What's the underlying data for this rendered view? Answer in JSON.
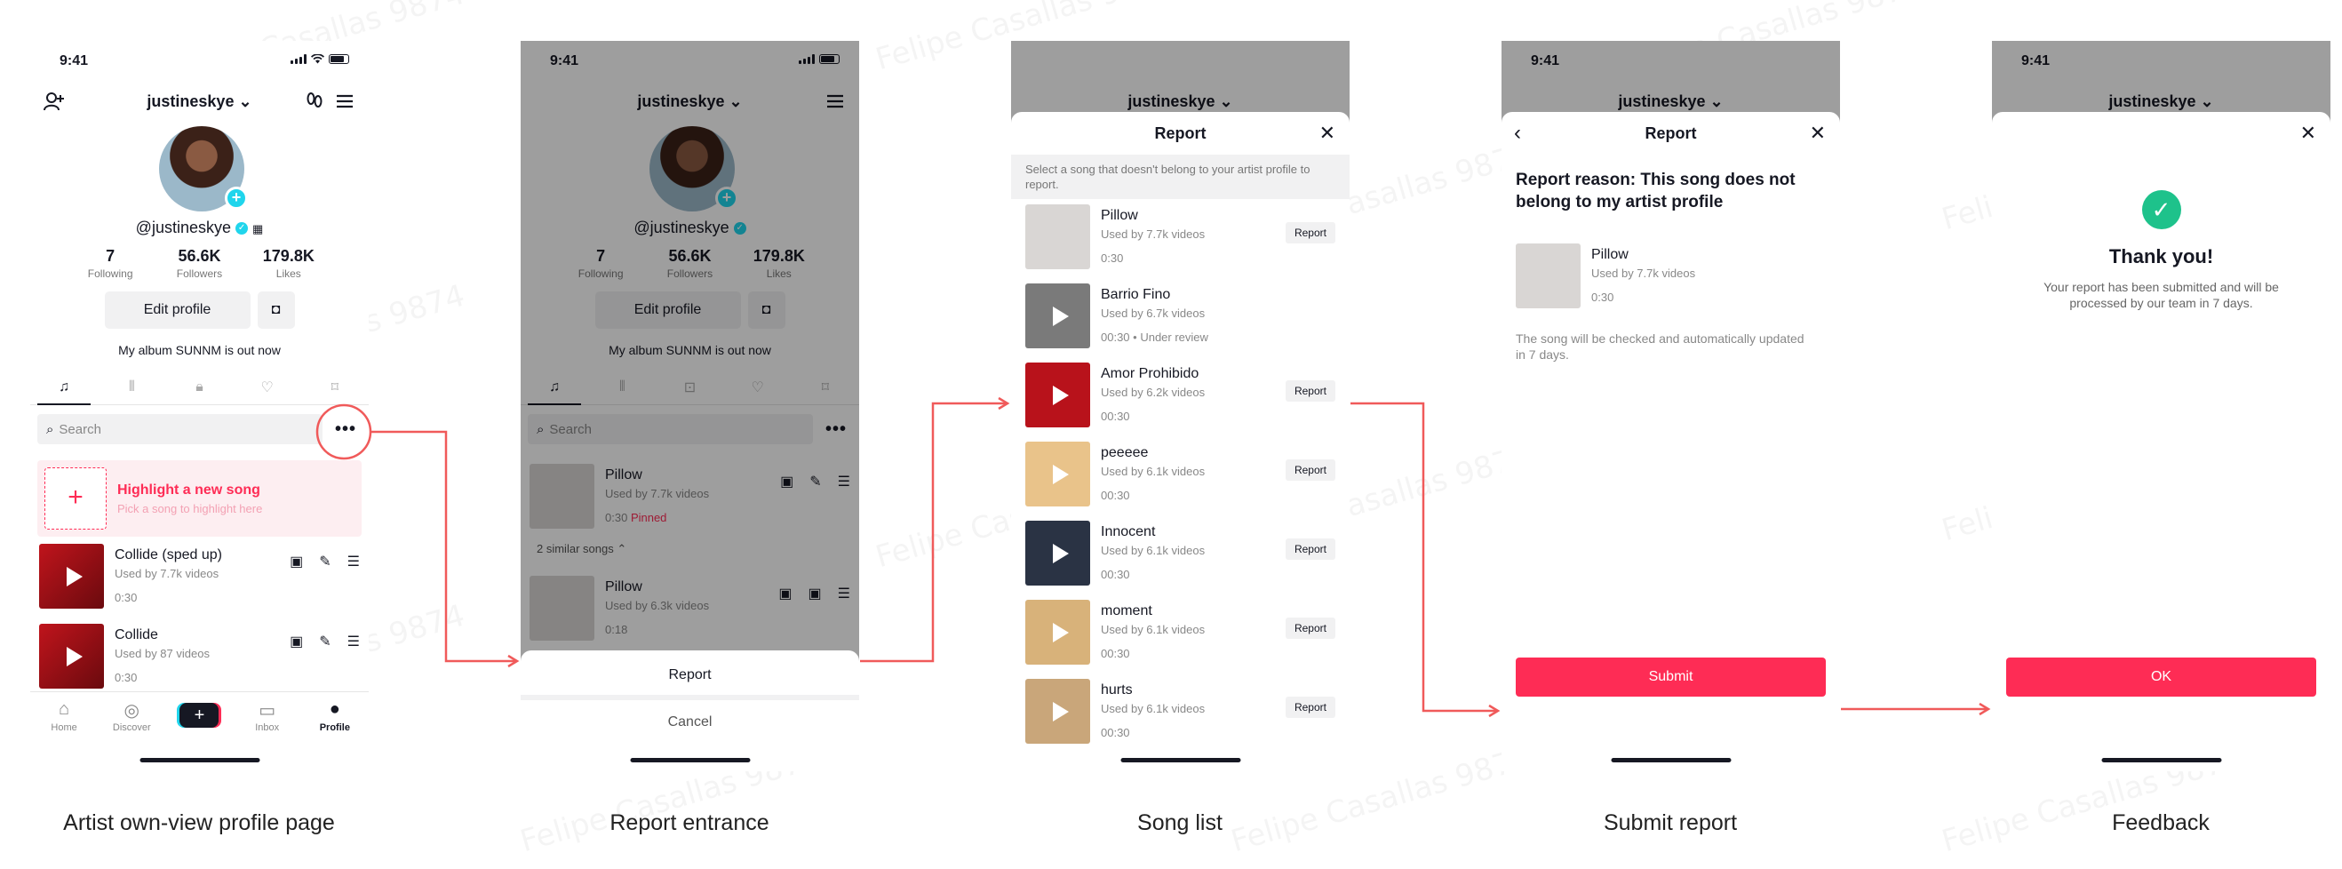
{
  "watermark": "Felipe Casallas 9874",
  "status_time": "9:41",
  "username": "justineskye",
  "handle": "@justineskye",
  "stats": [
    {
      "value": "7",
      "label": "Following"
    },
    {
      "value": "56.6K",
      "label": "Followers"
    },
    {
      "value": "179.8K",
      "label": "Likes"
    }
  ],
  "edit_profile": "Edit profile",
  "bio": "My album SUNNM  is out now",
  "search_placeholder": "Search",
  "highlight": {
    "title": "Highlight a new song",
    "subtitle": "Pick a song to highlight here"
  },
  "own_songs": [
    {
      "title": "Collide (sped up)",
      "used": "Used by 7.7k videos",
      "duration": "0:30"
    },
    {
      "title": "Collide",
      "used": "Used by 87 videos",
      "duration": "0:30"
    }
  ],
  "nav": [
    "Home",
    "Discover",
    "",
    "Inbox",
    "Profile"
  ],
  "screen2": {
    "song1": {
      "title": "Pillow",
      "used": "Used by 7.7k videos",
      "duration": "0:30",
      "pinned": "Pinned"
    },
    "similar": "2 similar songs",
    "song2": {
      "title": "Pillow",
      "used": "Used by 6.3k videos",
      "duration": "0:18"
    },
    "report": "Report",
    "cancel": "Cancel"
  },
  "screen3": {
    "title": "Report",
    "instruction": "Select a song that doesn't belong to your artist profile to report.",
    "report_label": "Report",
    "songs": [
      {
        "title": "Pillow",
        "used": "Used by 7.7k videos",
        "duration": "0:30",
        "status": "",
        "art": "#d9d6d4"
      },
      {
        "title": "Barrio Fino",
        "used": "Used by 6.7k videos",
        "duration": "00:30",
        "status": " • Under review",
        "art": "#7a7a7a"
      },
      {
        "title": "Amor Prohibido",
        "used": "Used by 6.2k videos",
        "duration": "00:30",
        "status": "",
        "art": "#b8121b"
      },
      {
        "title": "peeeee",
        "used": "Used by 6.1k videos",
        "duration": "00:30",
        "status": "",
        "art": "#e9c38a"
      },
      {
        "title": "Innocent",
        "used": "Used by 6.1k videos",
        "duration": "00:30",
        "status": "",
        "art": "#2a3344"
      },
      {
        "title": "moment",
        "used": "Used by 6.1k videos",
        "duration": "00:30",
        "status": "",
        "art": "#d8b27a"
      },
      {
        "title": "hurts",
        "used": "Used by 6.1k videos",
        "duration": "00:30",
        "status": "",
        "art": "#c9a67a"
      }
    ]
  },
  "screen4": {
    "title": "Report",
    "reason": "Report reason: This song does not belong to my artist profile",
    "song": {
      "title": "Pillow",
      "used": "Used by 7.7k videos",
      "duration": "0:30"
    },
    "note": "The song will be checked and automatically updated in 7 days.",
    "submit": "Submit"
  },
  "screen5": {
    "title": "Thank you!",
    "message": "Your report has been submitted and will be processed by our team in 7 days.",
    "ok": "OK"
  },
  "captions": [
    "Artist own-view profile page",
    "Report entrance",
    "Song list",
    "Submit report",
    "Feedback"
  ],
  "colors": {
    "accent": "#fe2c55",
    "success": "#1ec28b",
    "verified": "#20d5ec"
  }
}
